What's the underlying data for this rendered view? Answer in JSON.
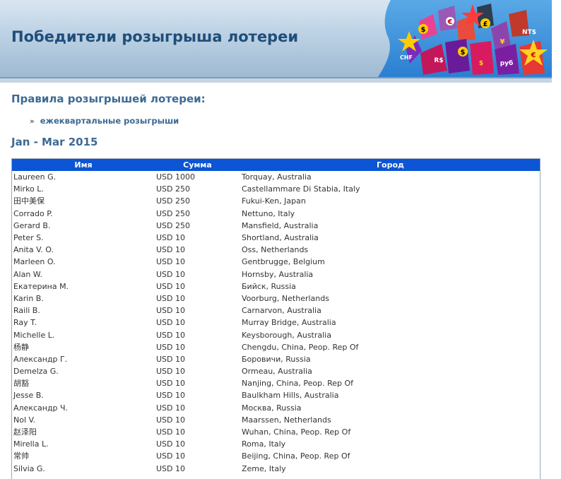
{
  "header": {
    "title": "Победители розыгрыша лотереи",
    "banner_labels": [
      "$",
      "€",
      "£",
      "¥",
      "NT$",
      "CHF",
      "R$",
      "$",
      "руб",
      "€",
      "$"
    ]
  },
  "rules": {
    "heading": "Правила розыгрышей лотереи:",
    "bullet": "»",
    "link_label": "ежеквартальные розыгрыши"
  },
  "period": "Jan - Mar 2015",
  "table": {
    "columns": [
      "Имя",
      "Сумма",
      "Город"
    ],
    "rows": [
      [
        "Laureen G.",
        "USD 1000",
        "Torquay, Australia"
      ],
      [
        "Mirko L.",
        "USD 250",
        "Castellammare Di Stabia, Italy"
      ],
      [
        "田中美保",
        "USD 250",
        "Fukui-Ken, Japan"
      ],
      [
        "Corrado P.",
        "USD 250",
        "Nettuno, Italy"
      ],
      [
        "Gerard B.",
        "USD 250",
        "Mansfield, Australia"
      ],
      [
        "Peter S.",
        "USD 10",
        "Shortland, Australia"
      ],
      [
        "Anita V. O.",
        "USD 10",
        "Oss, Netherlands"
      ],
      [
        "Marleen O.",
        "USD 10",
        "Gentbrugge, Belgium"
      ],
      [
        "Alan W.",
        "USD 10",
        "Hornsby, Australia"
      ],
      [
        "Екатерина М.",
        "USD 10",
        "Бийск, Russia"
      ],
      [
        "Karin B.",
        "USD 10",
        "Voorburg, Netherlands"
      ],
      [
        "Raili B.",
        "USD 10",
        "Carnarvon, Australia"
      ],
      [
        "Ray T.",
        "USD 10",
        "Murray Bridge, Australia"
      ],
      [
        "Michelle L.",
        "USD 10",
        "Keysborough, Australia"
      ],
      [
        "杨静",
        "USD 10",
        "Chengdu, China, Peop. Rep Of"
      ],
      [
        "Александр Г.",
        "USD 10",
        "Боровичи, Russia"
      ],
      [
        "Demelza G.",
        "USD 10",
        "Ormeau, Australia"
      ],
      [
        "胡豁",
        "USD 10",
        "Nanjing, China, Peop. Rep Of"
      ],
      [
        "Jesse B.",
        "USD 10",
        "Baulkham Hills, Australia"
      ],
      [
        "Александр Ч.",
        "USD 10",
        "Москва, Russia"
      ],
      [
        "Nol V.",
        "USD 10",
        "Maarssen, Netherlands"
      ],
      [
        "赵泽阳",
        "USD 10",
        "Wuhan, China, Peop. Rep Of"
      ],
      [
        "Mirella L.",
        "USD 10",
        "Roma, Italy"
      ],
      [
        "常帅",
        "USD 10",
        "Beijing, China, Peop. Rep Of"
      ],
      [
        "Silvia G.",
        "USD 10",
        "Zeme, Italy"
      ]
    ]
  },
  "colors": {
    "header_title": "#1f4e7a",
    "heading": "#3d6a93",
    "table_header_bg": "#0c55d4",
    "table_header_text": "#ffffff"
  }
}
